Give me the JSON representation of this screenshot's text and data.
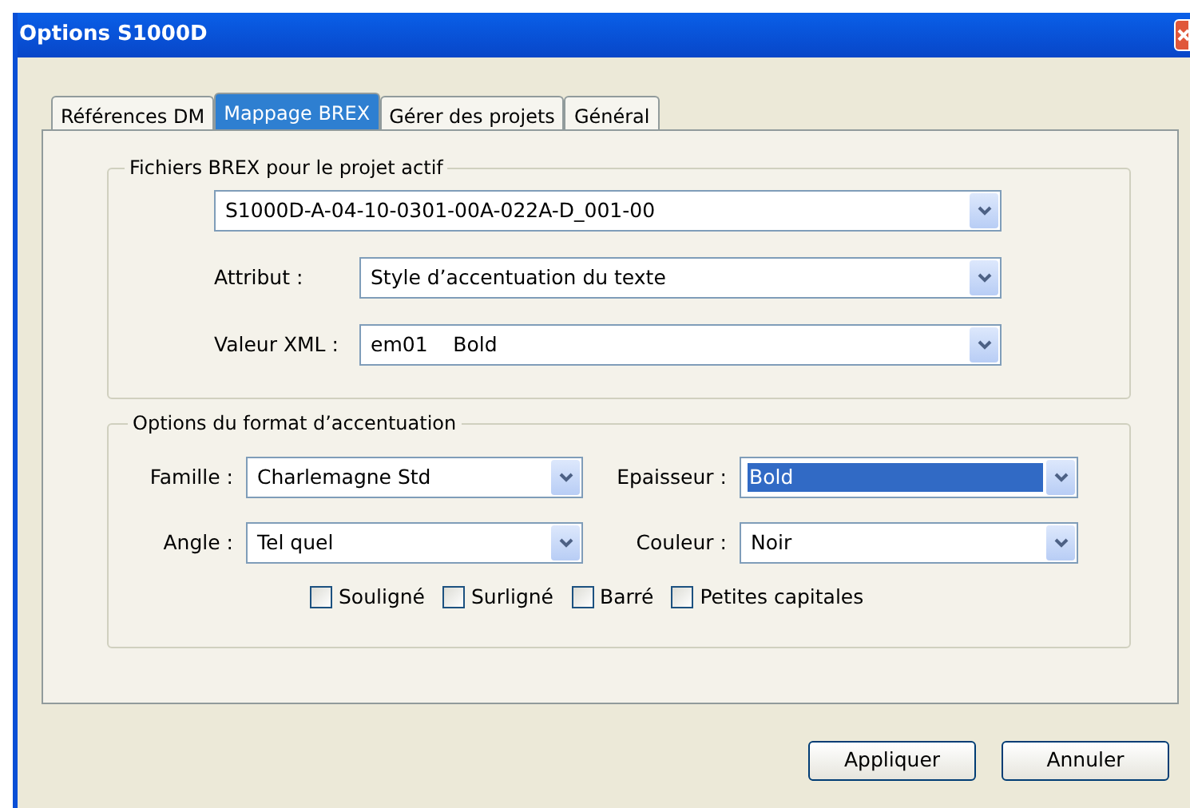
{
  "window": {
    "title": "Options S1000D"
  },
  "tabs": [
    {
      "label": "Références DM",
      "selected": false
    },
    {
      "label": "Mappage BREX",
      "selected": true
    },
    {
      "label": "Gérer des projets",
      "selected": false
    },
    {
      "label": "Général",
      "selected": false
    }
  ],
  "brex_group": {
    "title": "Fichiers BREX pour le projet actif",
    "file": {
      "value": "S1000D-A-04-10-0301-00A-022A-D_001-00"
    },
    "fields": [
      {
        "label": "Attribut :",
        "value": "Style d’accentuation du texte"
      },
      {
        "label": "Valeur XML :",
        "value": "em01    Bold"
      }
    ]
  },
  "format_group": {
    "title": "Options du format d’accentuation",
    "fields": [
      {
        "label": "Famille :",
        "value": "Charlemagne Std",
        "highlighted": false
      },
      {
        "label": "Epaisseur :",
        "value": "Bold",
        "highlighted": true
      },
      {
        "label": "Angle :",
        "value": "Tel quel",
        "highlighted": false
      },
      {
        "label": "Couleur :",
        "value": "Noir",
        "highlighted": false
      }
    ],
    "checkboxes": [
      {
        "label": "Souligné",
        "checked": false
      },
      {
        "label": "Surligné",
        "checked": false
      },
      {
        "label": "Barré",
        "checked": false
      },
      {
        "label": "Petites capitales",
        "checked": false
      }
    ]
  },
  "buttons": [
    {
      "label": "Appliquer"
    },
    {
      "label": "Annuler"
    }
  ]
}
